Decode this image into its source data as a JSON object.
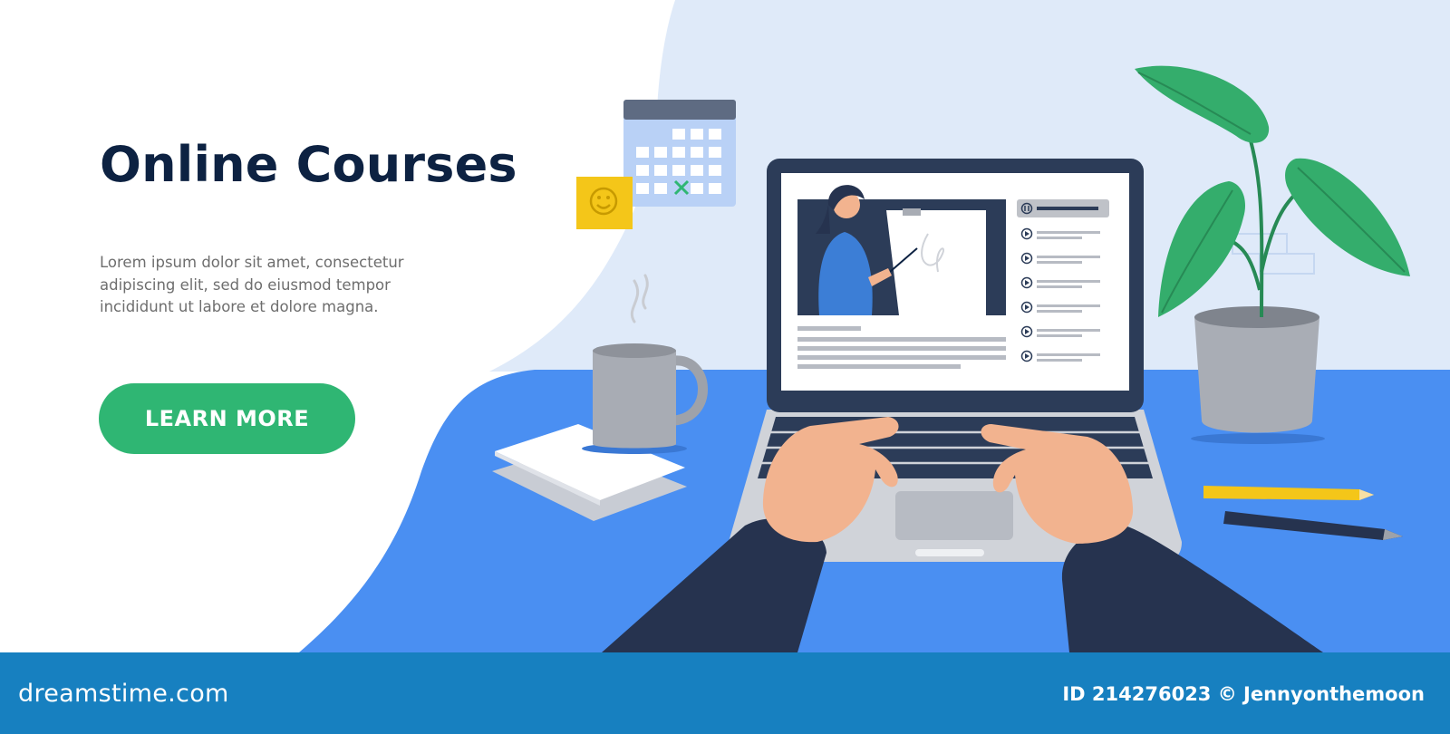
{
  "hero": {
    "title": "Online Courses",
    "description": "Lorem ipsum dolor sit amet, consectetur adipiscing elit, sed do eiusmod tempor incididunt ut labore et dolore magna.",
    "cta_label": "LEARN MORE"
  },
  "footer": {
    "logo": "dreamstime.com",
    "credit": "ID 214276023 © Jennyonthemoon"
  },
  "colors": {
    "title": "#0d2242",
    "cta": "#2fb673",
    "desk": "#4a8ff2",
    "wall": "#dfeaf9",
    "footer": "#1780c0",
    "laptop": "#2c3c58",
    "sleeve": "#26334f",
    "plant": "#34ad6c"
  },
  "icons": [
    "calendar-icon",
    "smiley-note-icon",
    "play-icon",
    "pause-icon",
    "coffee-mug-icon",
    "plant-icon",
    "pencil-icon"
  ]
}
